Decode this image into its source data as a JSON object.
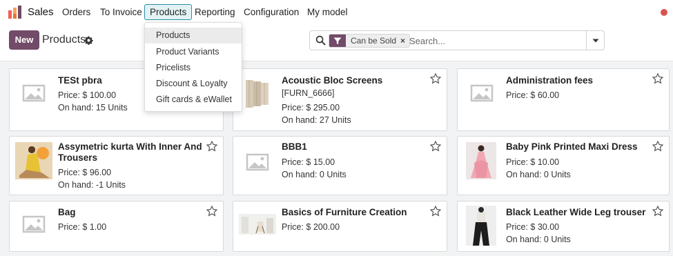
{
  "app": {
    "name": "Sales"
  },
  "nav": {
    "items": [
      {
        "label": "Orders"
      },
      {
        "label": "To Invoice"
      },
      {
        "label": "Products"
      },
      {
        "label": "Reporting"
      },
      {
        "label": "Configuration"
      },
      {
        "label": "My model"
      }
    ],
    "active": "Products"
  },
  "control_panel": {
    "new_label": "New",
    "title": "Products"
  },
  "search": {
    "facet_label": "Can be Sold",
    "facet_remove": "×",
    "placeholder": "Search..."
  },
  "dropdown": {
    "items": [
      {
        "label": "Products"
      },
      {
        "label": "Product Variants"
      },
      {
        "label": "Pricelists"
      },
      {
        "label": "Discount & Loyalty"
      },
      {
        "label": "Gift cards & eWallet"
      }
    ],
    "selected": "Products"
  },
  "products": [
    {
      "name": "TESt pbra",
      "price": "Price: $ 100.00",
      "onhand": "On hand: 15 Units",
      "image": "placeholder"
    },
    {
      "name": "Acoustic Bloc Screens",
      "ref": "[FURN_6666]",
      "price": "Price: $ 295.00",
      "onhand": "On hand: 27 Units",
      "image": "screens"
    },
    {
      "name": "Administration fees",
      "price": "Price: $ 60.00",
      "image": "placeholder"
    },
    {
      "name": "Assymetric kurta With Inner And Trousers",
      "price": "Price: $ 96.00",
      "onhand": "On hand: -1 Units",
      "image": "kurta"
    },
    {
      "name": "BBB1",
      "price": "Price: $ 15.00",
      "onhand": "On hand: 0 Units",
      "image": "placeholder"
    },
    {
      "name": "Baby Pink Printed Maxi Dress",
      "price": "Price: $ 10.00",
      "onhand": "On hand: 0 Units",
      "image": "dress"
    },
    {
      "name": "Bag",
      "price": "Price: $ 1.00",
      "image": "placeholder"
    },
    {
      "name": "Basics of Furniture Creation",
      "price": "Price: $ 200.00",
      "image": "furniture"
    },
    {
      "name": "Black Leather Wide Leg trouser",
      "price": "Price: $ 30.00",
      "onhand": "On hand: 0 Units",
      "image": "trouser"
    }
  ],
  "colors": {
    "brand": "#714b67",
    "active_nav_border": "#2a8fa5",
    "status_dot": "#d9534f",
    "background": "#f2f3f5"
  },
  "icons": [
    "app-logo-icon",
    "gear-icon",
    "search-icon",
    "filter-icon",
    "chevron-down-icon",
    "star-icon",
    "image-placeholder-icon"
  ]
}
